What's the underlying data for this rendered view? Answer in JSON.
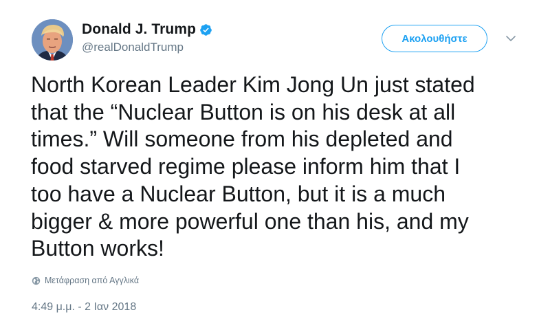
{
  "author": {
    "display_name": "Donald J. Trump",
    "handle": "@realDonaldTrump",
    "verified": true,
    "avatar_icon": "profile-photo"
  },
  "header": {
    "follow_label": "Ακολουθήστε",
    "more_icon": "chevron-down-icon"
  },
  "tweet": {
    "text": "North Korean Leader Kim Jong Un just stated\nthat the “Nuclear Button is on his desk at all\ntimes.” Will someone from his depleted and\nfood starved regime please inform him that I\ntoo have a Nuclear Button, but it is a much\nbigger & more powerful one than his, and my\nButton works!",
    "translate_label": "Μετάφραση από Αγγλικά",
    "translate_icon": "globe-icon",
    "timestamp": "4:49 μ.μ. - 2 Ιαν 2018"
  },
  "colors": {
    "accent": "#1da1f2",
    "text_primary": "#14171a",
    "text_secondary": "#657786"
  }
}
